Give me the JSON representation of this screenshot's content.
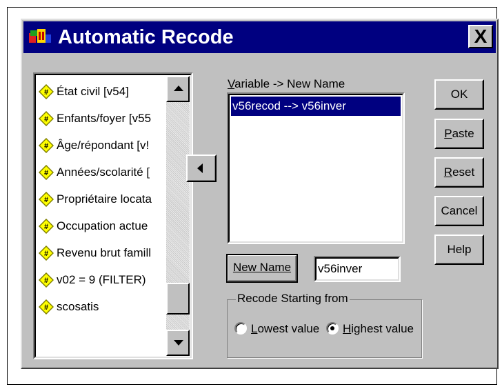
{
  "dialog": {
    "title": "Automatic Recode",
    "close_label": "X"
  },
  "variables": {
    "items": [
      {
        "label": "État civil [v54]"
      },
      {
        "label": "Enfants/foyer [v55"
      },
      {
        "label": "Âge/répondant [v!"
      },
      {
        "label": "Années/scolarité ["
      },
      {
        "label": "Propriétaire locata"
      },
      {
        "label": "Occupation actue"
      },
      {
        "label": "Revenu brut famill"
      },
      {
        "label": "v02 = 9 (FILTER)"
      },
      {
        "label": "scosatis"
      }
    ],
    "icon": "variable-hash-icon"
  },
  "mapping": {
    "header": "Variable -> New Name",
    "header_underlined_char": "V",
    "header_rest": "ariable -> New Name",
    "items": [
      "v56recod --> v56inver"
    ]
  },
  "new_name": {
    "button_label": "New Name",
    "value": "v56inver"
  },
  "recode_group": {
    "legend": "Recode Starting from",
    "lowest_u": "L",
    "lowest_rest": "owest value",
    "highest_u": "H",
    "highest_rest": "ighest value",
    "selected": "highest"
  },
  "buttons": {
    "ok": "OK",
    "paste_u": "P",
    "paste_rest": "aste",
    "reset_u": "R",
    "reset_rest": "eset",
    "cancel": "Cancel",
    "help": "Help"
  },
  "colors": {
    "titlebar": "#000080",
    "dialog_bg": "#c0c0c0",
    "selection": "#000080",
    "icon_yellow": "#ffff00"
  }
}
